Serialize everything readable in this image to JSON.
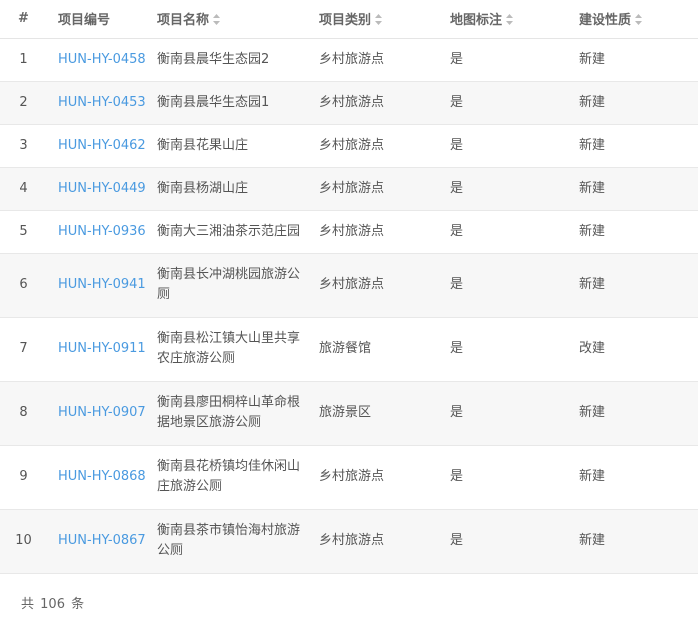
{
  "columns": [
    {
      "key": "index",
      "label": "#",
      "sortable": false
    },
    {
      "key": "code",
      "label": "项目编号",
      "sortable": false
    },
    {
      "key": "name",
      "label": "项目名称",
      "sortable": true
    },
    {
      "key": "type",
      "label": "项目类别",
      "sortable": true
    },
    {
      "key": "map",
      "label": "地图标注",
      "sortable": true
    },
    {
      "key": "build",
      "label": "建设性质",
      "sortable": true
    }
  ],
  "rows": [
    {
      "index": "1",
      "code": "HUN-HY-0458",
      "name": "衡南县晨华生态园2",
      "type": "乡村旅游点",
      "map": "是",
      "build": "新建"
    },
    {
      "index": "2",
      "code": "HUN-HY-0453",
      "name": "衡南县晨华生态园1",
      "type": "乡村旅游点",
      "map": "是",
      "build": "新建"
    },
    {
      "index": "3",
      "code": "HUN-HY-0462",
      "name": "衡南县花果山庄",
      "type": "乡村旅游点",
      "map": "是",
      "build": "新建"
    },
    {
      "index": "4",
      "code": "HUN-HY-0449",
      "name": "衡南县杨湖山庄",
      "type": "乡村旅游点",
      "map": "是",
      "build": "新建"
    },
    {
      "index": "5",
      "code": "HUN-HY-0936",
      "name": "衡南大三湘油茶示范庄园",
      "type": "乡村旅游点",
      "map": "是",
      "build": "新建"
    },
    {
      "index": "6",
      "code": "HUN-HY-0941",
      "name": "衡南县长冲湖桃园旅游公厕",
      "type": "乡村旅游点",
      "map": "是",
      "build": "新建"
    },
    {
      "index": "7",
      "code": "HUN-HY-0911",
      "name": "衡南县松江镇大山里共享农庄旅游公厕",
      "type": "旅游餐馆",
      "map": "是",
      "build": "改建"
    },
    {
      "index": "8",
      "code": "HUN-HY-0907",
      "name": "衡南县廖田桐梓山革命根据地景区旅游公厕",
      "type": "旅游景区",
      "map": "是",
      "build": "新建"
    },
    {
      "index": "9",
      "code": "HUN-HY-0868",
      "name": "衡南县花桥镇均佳休闲山庄旅游公厕",
      "type": "乡村旅游点",
      "map": "是",
      "build": "新建"
    },
    {
      "index": "10",
      "code": "HUN-HY-0867",
      "name": "衡南县茶市镇怡海村旅游公厕",
      "type": "乡村旅游点",
      "map": "是",
      "build": "新建"
    }
  ],
  "footer": {
    "prefix": "共",
    "total": "106",
    "suffix": "条"
  },
  "colors": {
    "link": "#4a9ae0",
    "stripe": "#f7f7f7",
    "border": "#e8e8e8"
  }
}
